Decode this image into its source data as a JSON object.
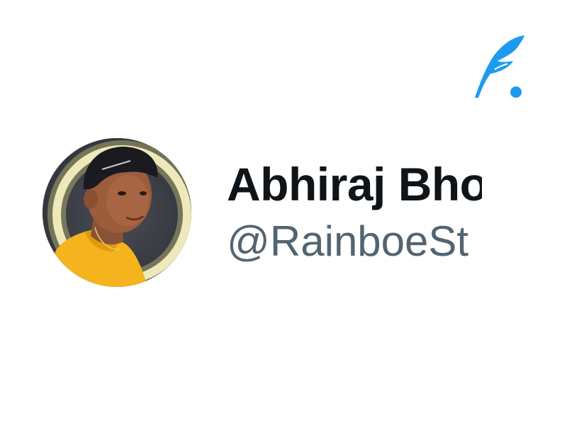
{
  "brand": {
    "icon": "feather-quill-icon",
    "color": "#1d9bf0"
  },
  "profile": {
    "display_name": "Abhiraj Bho",
    "handle": "@RainboeSt",
    "name_color": "#0f1419",
    "handle_color": "#536471"
  },
  "avatar": {
    "ring_color": "#f4f0b0",
    "shirt_color": "#f5b41e"
  }
}
